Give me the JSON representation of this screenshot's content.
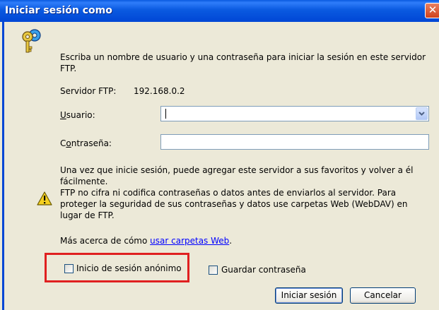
{
  "window": {
    "title": "Iniciar sesión como",
    "close_glyph": "✕"
  },
  "message": {
    "prompt": "Escriba un nombre de usuario y una contraseña para iniciar la sesión en este servidor FTP."
  },
  "server": {
    "label": "Servidor FTP:",
    "value": "192.168.0.2"
  },
  "user": {
    "label": "Usuario:",
    "value": ""
  },
  "password": {
    "label": "Contraseña:",
    "value": ""
  },
  "info": {
    "favorites_note": "Una vez que inicie sesión, puede agregar este servidor a sus favoritos y volver a él fácilmente.",
    "warning": "FTP no cifra ni codifica contraseñas o datos antes de enviarlos al servidor.  Para proteger la seguridad de sus contraseñas y datos use carpetas Web (WebDAV) en lugar de FTP.",
    "more_prefix": "Más acerca de cómo ",
    "more_link": "usar carpetas Web",
    "more_suffix": "."
  },
  "options": {
    "anonymous": {
      "label": "Inicio de sesión anónimo",
      "checked": false
    },
    "save_password": {
      "label": "Guardar contraseña",
      "checked": false
    }
  },
  "buttons": {
    "login": "Iniciar sesión",
    "cancel": "Cancelar"
  },
  "icons": {
    "keys": "keys-icon",
    "warning": "warning-icon",
    "close": "close-icon",
    "dropdown": "chevron-down-icon"
  },
  "colors": {
    "titlebar": "#0a5ae0",
    "highlight": "#e02020",
    "link": "#0000ff"
  }
}
